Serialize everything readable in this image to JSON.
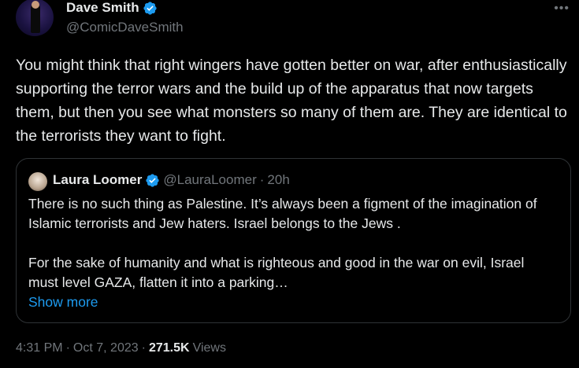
{
  "author": {
    "name": "Dave Smith",
    "handle": "@ComicDaveSmith",
    "verified": true
  },
  "tweet_text": "You might think that right wingers have gotten better on war, after enthusiastically supporting the terror wars and the build up of the apparatus that now targets them, but then you see what monsters so many of them are. They are identical to the terrorists they want to fight.",
  "quote": {
    "name": "Laura Loomer",
    "handle": "@LauraLoomer",
    "separator": "·",
    "time": "20h",
    "paragraph1": "There is no such thing as Palestine. It’s always been a figment of the imagination of Islamic terrorists and Jew haters. Israel belongs to the Jews .",
    "paragraph2": "For the sake of humanity and what is righteous and good in the war on evil, Israel must level GAZA, flatten it into a parking…",
    "show_more": "Show more"
  },
  "meta": {
    "time": "4:31 PM",
    "sep1": "·",
    "date": "Oct 7, 2023",
    "sep2": "·",
    "views_count": "271.5K",
    "views_label": "Views"
  },
  "icons": {
    "more": "more-horizontal-icon",
    "verified": "verified-badge-icon"
  },
  "colors": {
    "background": "#000000",
    "text": "#e7e9ea",
    "muted": "#71767b",
    "accent": "#1d9bf0",
    "border": "#2f3336"
  }
}
